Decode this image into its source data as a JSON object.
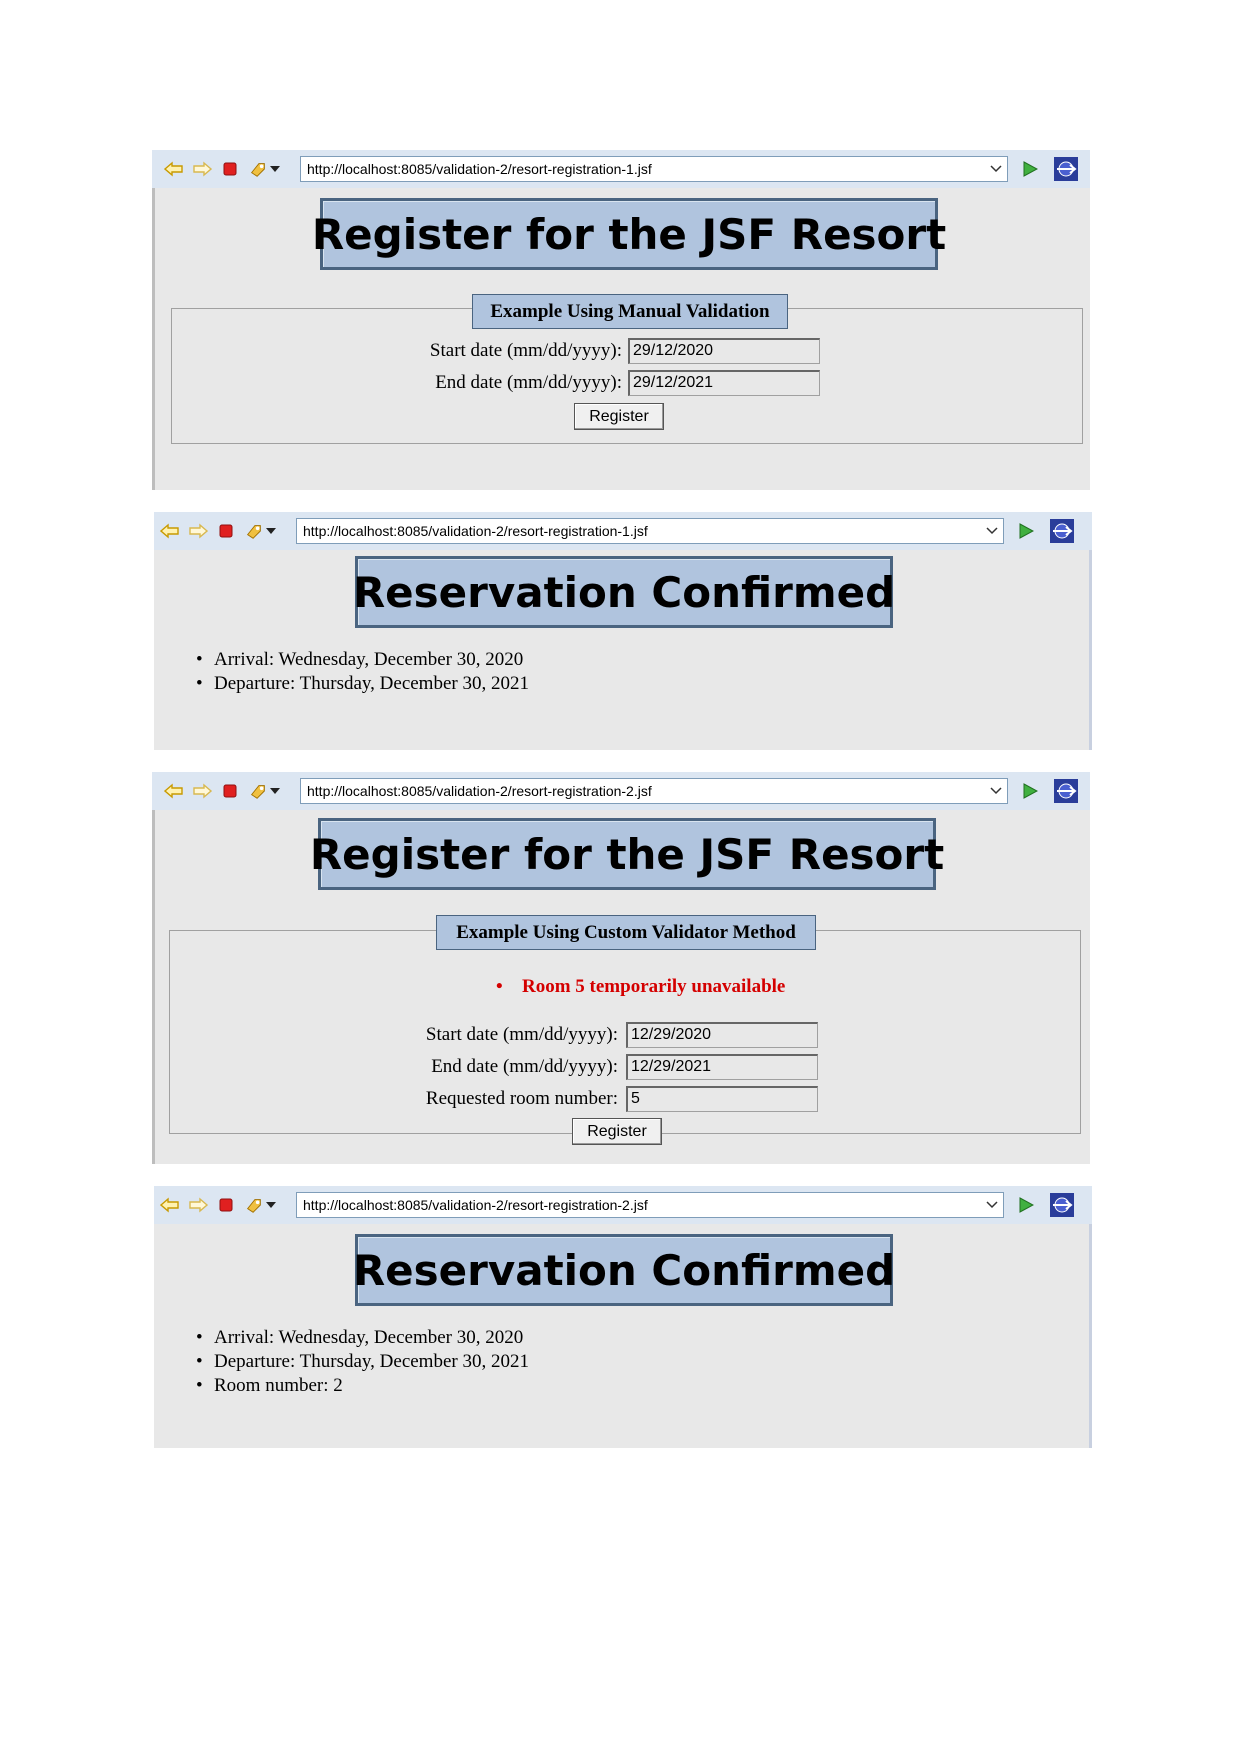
{
  "screenshots": [
    {
      "url": "http://localhost:8085/validation-2/resort-registration-1.jsf",
      "title": "Register for the JSF Resort",
      "legend": "Example Using Manual Validation",
      "fields": [
        {
          "label": "Start date (mm/dd/yyyy):",
          "value": "29/12/2020"
        },
        {
          "label": "End date (mm/dd/yyyy):",
          "value": "29/12/2021"
        }
      ],
      "button": "Register"
    },
    {
      "url": "http://localhost:8085/validation-2/resort-registration-1.jsf",
      "title": "Reservation Confirmed",
      "items": [
        "Arrival: Wednesday, December 30, 2020",
        "Departure: Thursday, December 30, 2021"
      ]
    },
    {
      "url": "http://localhost:8085/validation-2/resort-registration-2.jsf",
      "title": "Register for the JSF Resort",
      "legend": "Example Using Custom Validator Method",
      "error": "Room 5 temporarily unavailable",
      "fields": [
        {
          "label": "Start date (mm/dd/yyyy):",
          "value": "12/29/2020"
        },
        {
          "label": "End date (mm/dd/yyyy):",
          "value": "12/29/2021"
        },
        {
          "label": "Requested room number:",
          "value": "5"
        }
      ],
      "button": "Register"
    },
    {
      "url": "http://localhost:8085/validation-2/resort-registration-2.jsf",
      "title": "Reservation Confirmed",
      "items": [
        "Arrival: Wednesday, December 30, 2020",
        "Departure: Thursday, December 30, 2021",
        "Room number: 2"
      ]
    }
  ]
}
